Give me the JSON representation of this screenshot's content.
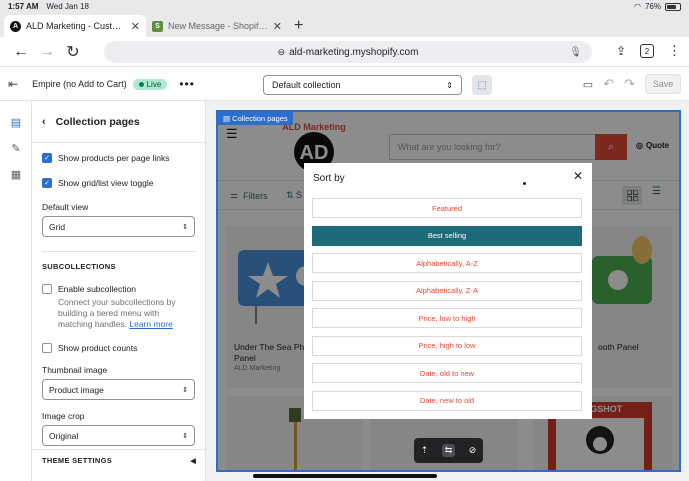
{
  "status": {
    "time": "1:57 AM",
    "date": "Wed Jan 18",
    "battery": "76%",
    "battery_level": 0.76
  },
  "tabs": [
    {
      "title": "ALD Marketing - Customi",
      "active": true
    },
    {
      "title": "New Message - Shopify C",
      "active": false
    }
  ],
  "browser": {
    "url": "ald-marketing.myshopify.com",
    "tab_count": "2",
    "new_tab": "+"
  },
  "editor": {
    "theme_name": "Empire (no Add to Cart)",
    "live_label": "Live",
    "more": "•••",
    "template": "Default collection",
    "save_label": "Save"
  },
  "panel": {
    "title": "Collection pages",
    "show_per_page": "Show products per page links",
    "show_grid_toggle": "Show grid/list view toggle",
    "default_view_label": "Default view",
    "default_view_value": "Grid",
    "subcollections_head": "SUBCOLLECTIONS",
    "enable_sub": "Enable subcollection",
    "sub_help": "Connect your subcollections by building a tiered menu with matching handles.",
    "learn_more": "Learn more",
    "show_counts": "Show product counts",
    "thumb_label": "Thumbnail image",
    "thumb_value": "Product image",
    "crop_label": "Image crop",
    "crop_value": "Original",
    "theme_settings": "THEME SETTINGS"
  },
  "preview": {
    "section_tag": "Collection pages",
    "logo_text": "ALD Marketing",
    "search_placeholder": "What are you looking for?",
    "quote": "Quote",
    "filters": "Filters",
    "sort_partial": "S",
    "products": [
      {
        "title": "Under The Sea Ph",
        "title2": "Panel",
        "vendor": "ALD Marketing"
      },
      {
        "title": "ooth Panel",
        "title2": "",
        "vendor": ""
      }
    ],
    "pugshot": "PUGSHOT"
  },
  "sort_modal": {
    "title": "Sort by",
    "close": "✕",
    "options": [
      {
        "label": "Featured",
        "selected": false
      },
      {
        "label": "Best selling",
        "selected": true
      },
      {
        "label": "Alphabetically, A-Z",
        "selected": false
      },
      {
        "label": "Alphabetically, Z-A",
        "selected": false
      },
      {
        "label": "Price, low to high",
        "selected": false
      },
      {
        "label": "Price, high to low",
        "selected": false
      },
      {
        "label": "Date, old to new",
        "selected": false
      },
      {
        "label": "Date, new to old",
        "selected": false
      }
    ]
  },
  "colors": {
    "accent": "#2c6ecb",
    "brand_red": "#e24b37",
    "selected_teal": "#1d6b7a",
    "live_green": "#aee9d1"
  }
}
